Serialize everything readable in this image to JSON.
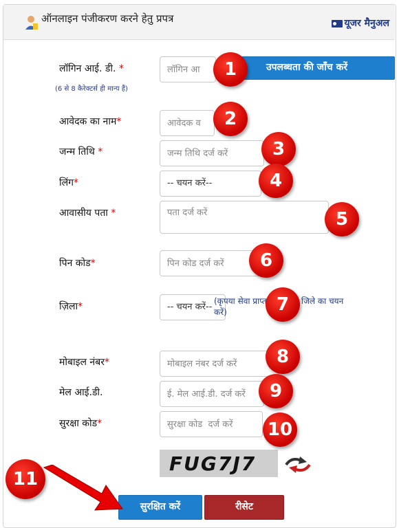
{
  "header": {
    "title": "ऑनलाइन पंजीकरण करने हेतु प्रपत्र",
    "manual_label": "यूजर मैनुअल"
  },
  "form": {
    "login_id": {
      "label": "लॉगिन आई. डी.",
      "placeholder": "लॉगिन आ",
      "note": "(6 से 8 कैरेक्टर्स ही मान्य हैं)",
      "check_button": "उपलब्धता की जाँच करें"
    },
    "applicant_name": {
      "label": "आवेदक का नाम",
      "placeholder": "आवेदक व"
    },
    "dob": {
      "label": "जन्म तिथि",
      "placeholder": "जन्म तिथि दर्ज करें"
    },
    "gender": {
      "label": "लिंग",
      "selected": "-- चयन करें--"
    },
    "address": {
      "label": "आवासीय पता",
      "placeholder": "पता दर्ज करें"
    },
    "pincode": {
      "label": "पिन कोड",
      "placeholder": "पिन कोड दर्ज करें"
    },
    "district": {
      "label": "ज़िला",
      "selected": "-- चयन करें--",
      "note": "(कृपया सेवा प्राप्त करने वाले जिले का चयन करें)"
    },
    "mobile": {
      "label": "मोबाइल नंबर",
      "placeholder": "मोबाइल नंबर दर्ज करें"
    },
    "email": {
      "label": "मेल आई.डी.",
      "placeholder": "ई. मेल आई.डी. दर्ज करें"
    },
    "security_code": {
      "label": "सुरक्षा कोड",
      "placeholder": "सुरक्षा कोड  दर्ज करें"
    },
    "captcha_text": "FUG7J7"
  },
  "buttons": {
    "save": "सुरक्षित करें",
    "reset": "रीसेट"
  },
  "required_mark": "*",
  "badges": [
    "1",
    "2",
    "3",
    "4",
    "5",
    "6",
    "7",
    "8",
    "9",
    "10",
    "11"
  ],
  "colors": {
    "primary_button": "#1e7fcf",
    "reset_button": "#a8282a",
    "badge": "#d40000"
  }
}
